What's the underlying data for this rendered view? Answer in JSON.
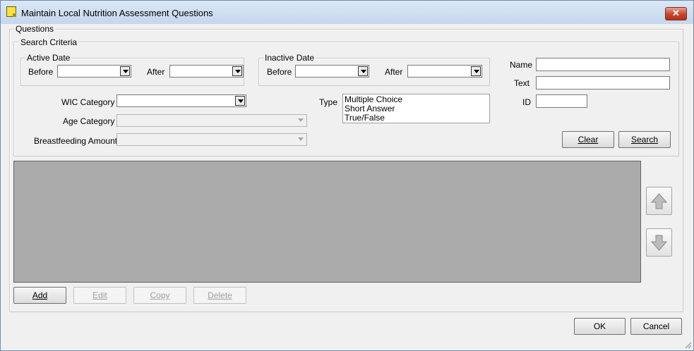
{
  "window": {
    "title": "Maintain Local Nutrition Assessment Questions",
    "close_glyph": "✕"
  },
  "questions_group": {
    "legend": "Questions"
  },
  "search_criteria": {
    "legend": "Search Criteria",
    "active_date": {
      "legend": "Active Date",
      "before_label": "Before",
      "after_label": "After"
    },
    "inactive_date": {
      "legend": "Inactive Date",
      "before_label": "Before",
      "after_label": "After"
    },
    "wic_category_label": "WIC Category",
    "age_category_label": "Age Category",
    "breastfeeding_amount_label": "Breastfeeding Amount",
    "type_label": "Type",
    "type_options": [
      "Multiple Choice",
      "Short Answer",
      "True/False"
    ],
    "name_label": "Name",
    "text_label": "Text",
    "id_label": "ID",
    "clear_label": "Clear",
    "search_label": "Search"
  },
  "list_actions": {
    "add": "Add",
    "edit": "Edit",
    "copy": "Copy",
    "delete": "Delete"
  },
  "reorder": {
    "up_icon": "arrow-up-icon",
    "down_icon": "arrow-down-icon"
  },
  "footer": {
    "ok": "OK",
    "cancel": "Cancel"
  },
  "colors": {
    "grid_background": "#ababab",
    "titlebar": "#c5d7ee"
  }
}
